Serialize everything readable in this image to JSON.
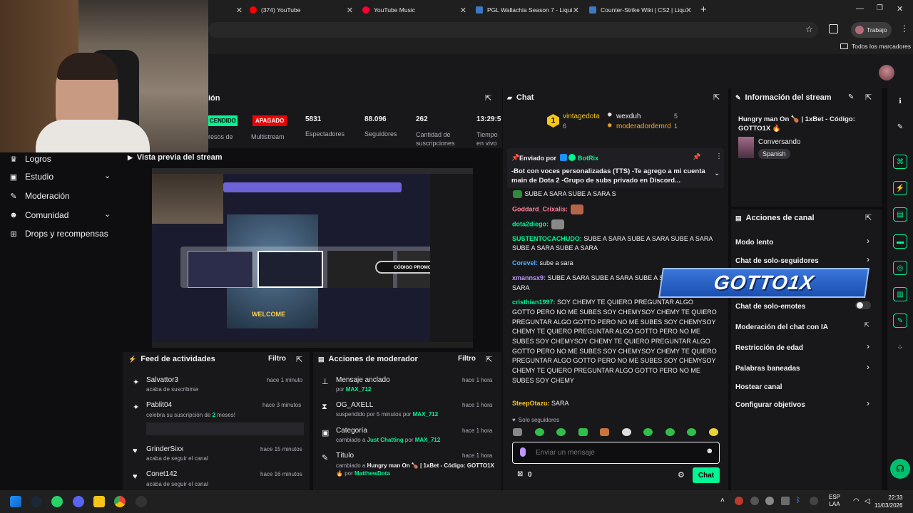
{
  "browser": {
    "tabs": [
      {
        "label": ""
      },
      {
        "label": "(374) YouTube"
      },
      {
        "label": "YouTube Music"
      },
      {
        "label": "PGL Wallachia Season 7 - Liqui"
      },
      {
        "label": "Counter-Strike Wiki | CS2 | Liqu"
      }
    ],
    "profile": "Trabajo",
    "bookmarks_label": "Todos los marcadores"
  },
  "leftnav": {
    "items": [
      {
        "label": "Logros",
        "icon": "trophy-icon"
      },
      {
        "label": "Estudio",
        "icon": "tv-icon"
      },
      {
        "label": "Moderación",
        "icon": "wrench-icon"
      },
      {
        "label": "Comunidad",
        "icon": "people-icon"
      },
      {
        "label": "Drops y recompensas",
        "icon": "gift-icon"
      }
    ]
  },
  "stats": {
    "title_partial": "ión",
    "badge_live": "CENDIDO",
    "badge_off": "APAGADO",
    "label_income": "resos de",
    "label_income2": "",
    "label_multistream": "Multistream",
    "viewers": "5831",
    "viewers_label": "Espectadores",
    "followers": "88.096",
    "followers_label": "Seguidores",
    "subs": "262",
    "subs_label": "Cantidad de suscripciones",
    "time": "13:29:5",
    "time_label": "Tiempo en vivo"
  },
  "preview": {
    "title": "Vista previa del stream",
    "promo": "CÓDIGO PROMOCIONAL:",
    "welcome": "WELCOME"
  },
  "feed": {
    "title": "Feed de actividades",
    "filter": "Filtro",
    "items": [
      {
        "name": "Salvattor3",
        "desc": "acaba de suscribirse",
        "time": "hace 1 minuto",
        "icon": "star-icon"
      },
      {
        "name": "Pablit04",
        "desc_pre": "celebra su suscripción de ",
        "desc_num": "2",
        "desc_post": " meses!",
        "time": "hace 3 minutos",
        "icon": "star-icon"
      },
      {
        "name": "GrinderSixx",
        "desc": "acaba de seguir el canal",
        "time": "hace 15 minutos",
        "icon": "heart-icon"
      },
      {
        "name": "Conet142",
        "desc": "acaba de seguir el canal",
        "time": "hace 16 minutos",
        "icon": "heart-icon"
      }
    ]
  },
  "modactions": {
    "title": "Acciones de moderador",
    "filter": "Filtro",
    "items": [
      {
        "title": "Mensaje anclado",
        "desc_pre": "por ",
        "user": "MAX_712",
        "time": "hace 1 hora"
      },
      {
        "title": "OG_AXELL",
        "desc_pre": "suspendido por 5 minutos por ",
        "user": "MAX_712",
        "time": "hace 1 hora"
      },
      {
        "title": "Categoría",
        "desc_pre": "cambiado a ",
        "user2": "Just Chatting",
        "desc_mid": " por ",
        "user": "MAX_712",
        "time": "hace 1 hora"
      },
      {
        "title": "Título",
        "desc_pre": "cambiado a ",
        "user2": "Hungry man On 🍗 | 1xBet - Código: GOTTO1X 🔥",
        "desc_mid": " por ",
        "user": "MatthewDota",
        "time": "hace 1 hora"
      }
    ]
  },
  "chat": {
    "title": "Chat",
    "leaderboard": [
      {
        "rank": "1",
        "name": "vintagedota",
        "count": "6"
      },
      {
        "name": "wexduh",
        "count": "5"
      },
      {
        "name": "moderadordemrd",
        "count": "1"
      }
    ],
    "pinned": {
      "label": "Enviado por",
      "user": "BotRix",
      "text": "-Bot con voces personalizadas (TTS) -Te agrego a mi cuenta main de Dota 2 -Grupo de subs privado en Discord..."
    },
    "messages": [
      {
        "user": "",
        "text": "SUBE A SARA   SUBE A SARA   S"
      },
      {
        "user": "Goddard_Crixalis:",
        "text": ""
      },
      {
        "user": "dota2diego:",
        "text": ""
      },
      {
        "user": "SUSTENTOCACHUDO:",
        "text": " SUBE A SARA   SUBE A SARA   SUBE A SARA   SUBE A SARA   SUBE A SARA"
      },
      {
        "user": "Corevel:",
        "text": " sube a sara"
      },
      {
        "user": "xmannsx9:",
        "text": " SUBE A SARA   SUBE A SARA   SUBE A SARA   SUBE A SARA"
      },
      {
        "user": "cristhian1997:",
        "text": " SOY CHEMY TE QUIERO PREGUNTAR ALGO GOTTO PERO NO ME SUBES SOY CHEMYSOY CHEMY TE QUIERO PREGUNTAR ALGO GOTTO PERO NO ME SUBES SOY CHEMYSOY CHEMY TE QUIERO PREGUNTAR ALGO GOTTO PERO NO ME SUBES SOY CHEMYSOY CHEMY TE QUIERO PREGUNTAR ALGO GOTTO PERO NO ME SUBES SOY CHEMYSOY CHEMY TE QUIERO PREGUNTAR ALGO GOTTO PERO NO ME SUBES SOY CHEMYSOY CHEMY TE QUIERO PREGUNTAR ALGO GOTTO PERO NO ME SUBES SOY CHEMY"
      },
      {
        "user": "SteepOtazu:",
        "text": " SARA"
      }
    ],
    "mode_label": "Solo seguidores",
    "placeholder": "Enviar un mensaje",
    "points": "0",
    "send": "Chat"
  },
  "streaminfo": {
    "title": "Información del stream",
    "stream_title": "Hungry man On 🍗 | 1xBet - Código: GOTTO1X 🔥",
    "category": "Conversando",
    "tag": "Spanish"
  },
  "channelactions": {
    "title": "Acciones de canal",
    "items": [
      {
        "label": "Modo lento",
        "chev": true
      },
      {
        "label": "Chat de solo-seguidores",
        "chev": true
      },
      {
        "label": "Chat de solo-emotes",
        "toggle": true
      },
      {
        "label": "Moderación del chat con IA",
        "ext": true
      },
      {
        "label": "Restricción de edad",
        "chev": true
      },
      {
        "label": "Palabras baneadas",
        "chev": true
      },
      {
        "label": "Hostear canal"
      },
      {
        "label": "Configurar objetivos",
        "chev": true
      }
    ],
    "overlay": "GOTTO1X"
  },
  "taskbar": {
    "lang": "ESP",
    "lang2": "LAA",
    "time": "22:33",
    "date": "11/03/2026"
  },
  "colors": {
    "accent": "#00f593",
    "bg": "#0e0e10",
    "panel": "#18181b",
    "red": "#eb0400",
    "purple": "#bf94ff"
  }
}
